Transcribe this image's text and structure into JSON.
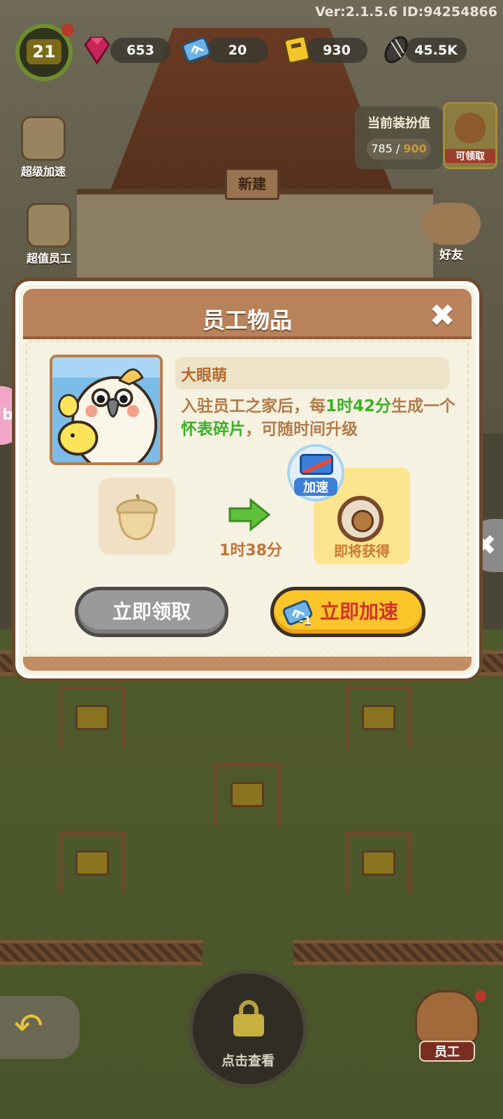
{
  "hud": {
    "version": "Ver:2.1.5.6 ID:94254866",
    "level": "21",
    "gems": "653",
    "tickets": "20",
    "coupons": "930",
    "seeds": "45.5K"
  },
  "scene": {
    "house_sign": "新建"
  },
  "left_buttons": {
    "super_speed": "超级加速",
    "value_staff": "超值员工"
  },
  "decoration": {
    "title": "当前装扮值",
    "current": "785",
    "max": "900",
    "claim_label": "可领取"
  },
  "friends_label": "好友",
  "dialog": {
    "title": "员工物品",
    "close_symbol": "✖",
    "staff_name": "大眼萌",
    "desc_part1": "入驻员工之家后，每",
    "desc_time": "1时42分",
    "desc_part2": "生成一个",
    "desc_item": "怀表碎片",
    "desc_part3": "，可随时间升级",
    "timer": "1时38分",
    "result_label": "即将获得",
    "speed_badge_label": "加速",
    "claim_button": "立即领取",
    "speed_button": "立即加速",
    "ticket_cost": "-1"
  },
  "bottom": {
    "view_label": "点击查看",
    "staff_label": "员工"
  },
  "side": {
    "left_tab": "bit",
    "right_close": "✖"
  }
}
